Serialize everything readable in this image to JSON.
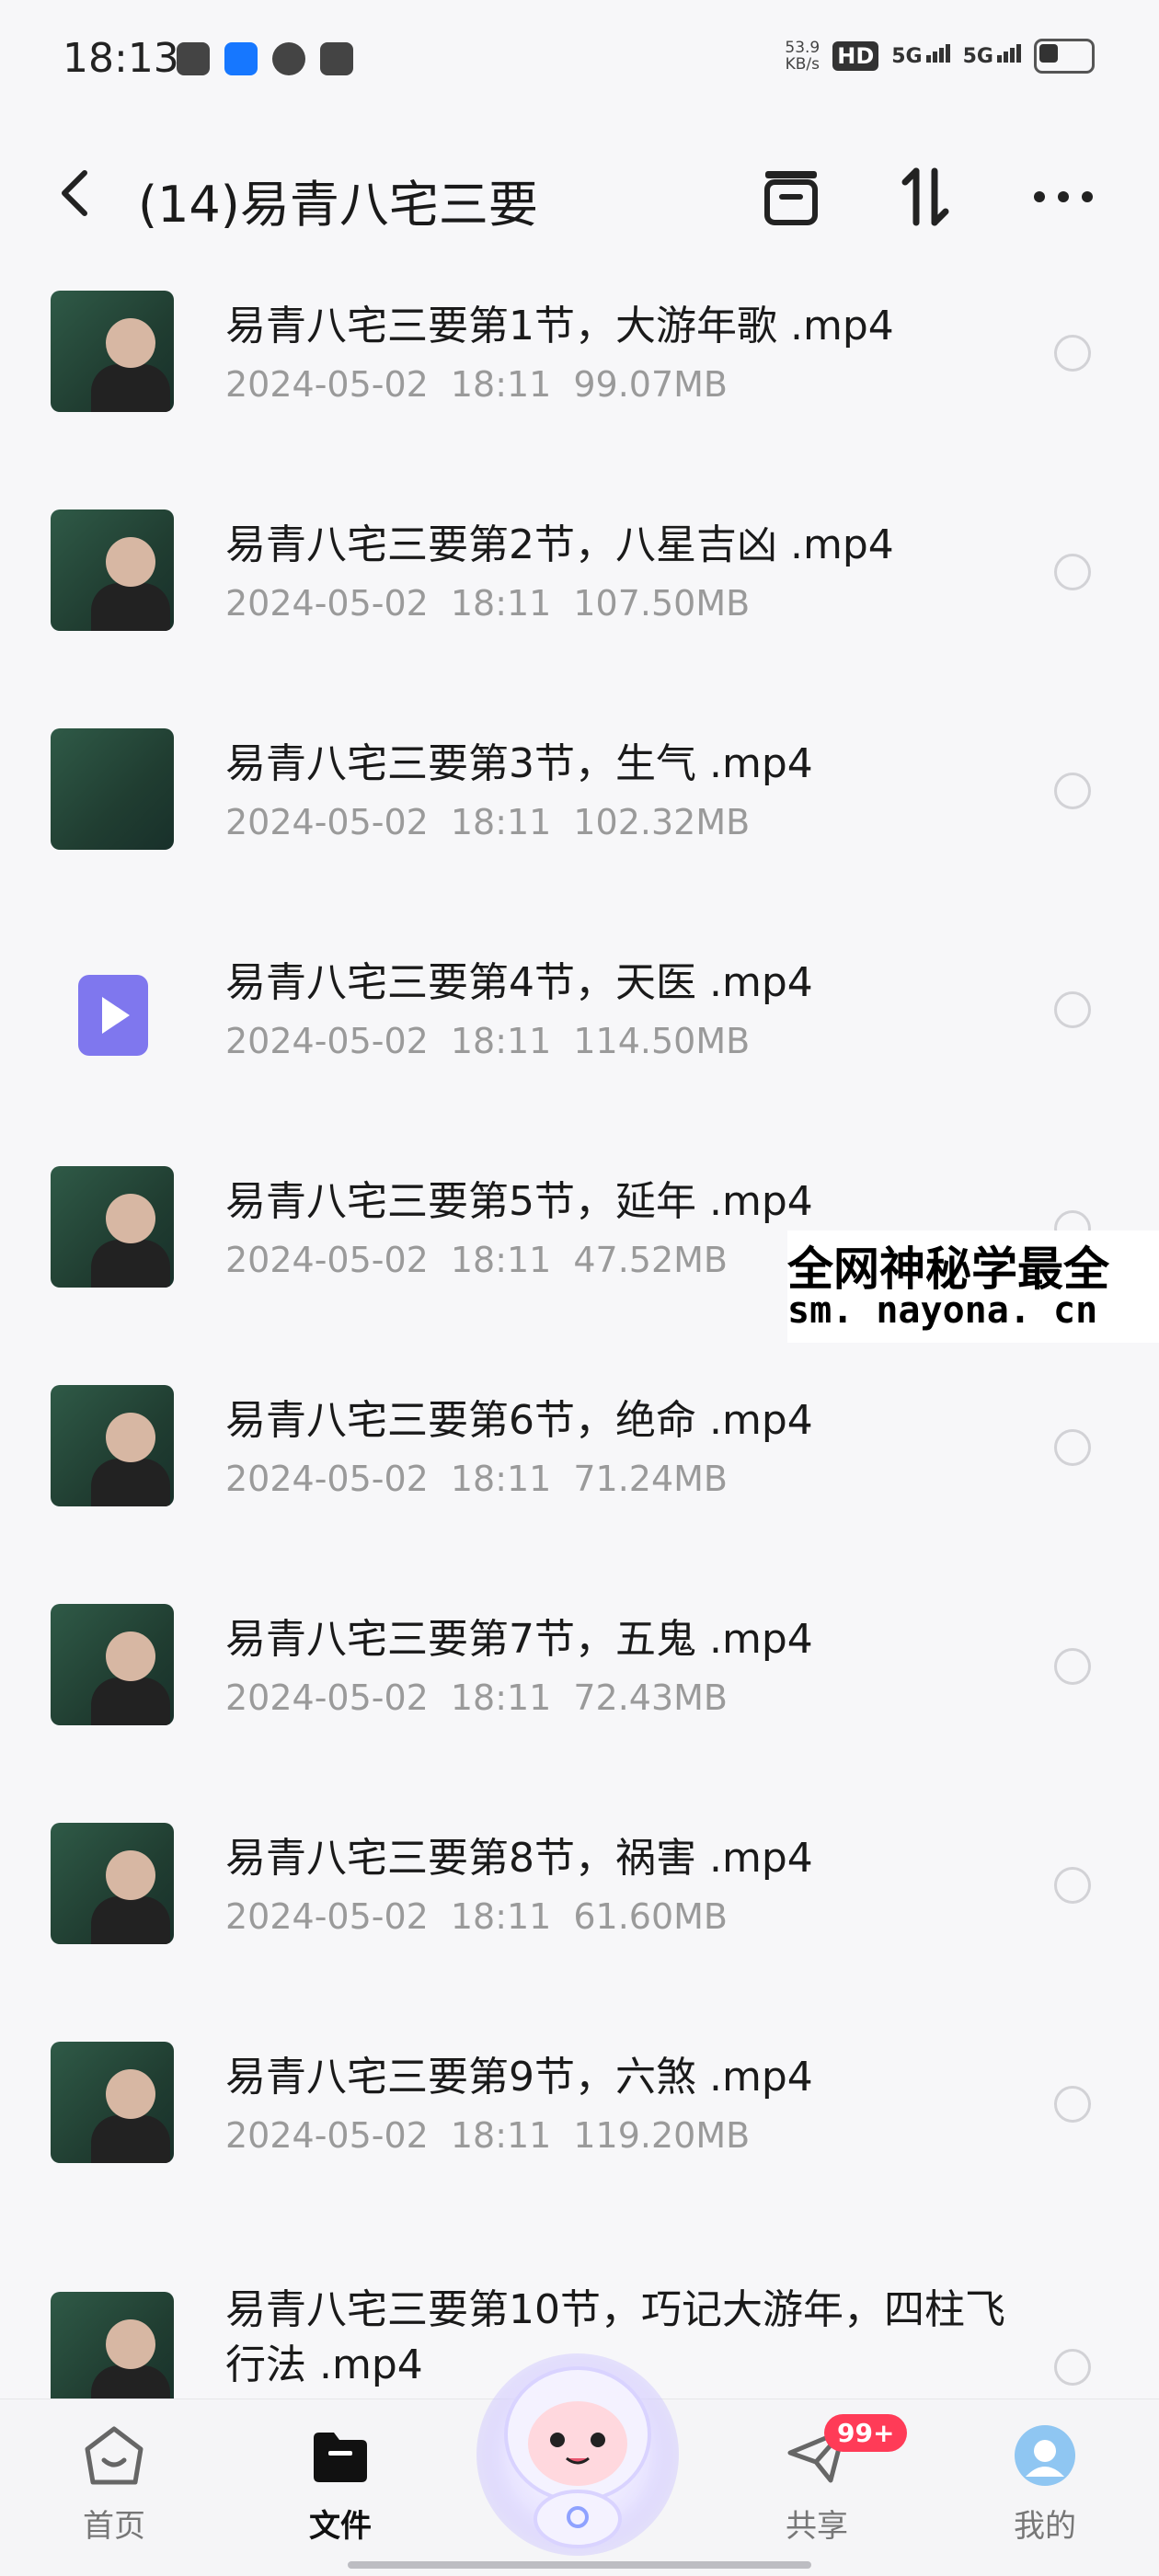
{
  "status_bar": {
    "time": "18:13",
    "speed_value": "53.9",
    "speed_unit": "KB/s",
    "hd": "HD",
    "sim1": "5G",
    "sim2": "5G"
  },
  "header": {
    "title": "(14)易青八宅三要"
  },
  "files": [
    {
      "name": "易青八宅三要第1节，大游年歌 .mp4",
      "date": "2024-05-02",
      "time": "18:11",
      "size": "99.07MB",
      "thumb": "video"
    },
    {
      "name": "易青八宅三要第2节，八星吉凶 .mp4",
      "date": "2024-05-02",
      "time": "18:11",
      "size": "107.50MB",
      "thumb": "video"
    },
    {
      "name": "易青八宅三要第3节，生气 .mp4",
      "date": "2024-05-02",
      "time": "18:11",
      "size": "102.32MB",
      "thumb": "video"
    },
    {
      "name": "易青八宅三要第4节，天医 .mp4",
      "date": "2024-05-02",
      "time": "18:11",
      "size": "114.50MB",
      "thumb": "play"
    },
    {
      "name": "易青八宅三要第5节，延年 .mp4",
      "date": "2024-05-02",
      "time": "18:11",
      "size": "47.52MB",
      "thumb": "video"
    },
    {
      "name": "易青八宅三要第6节，绝命 .mp4",
      "date": "2024-05-02",
      "time": "18:11",
      "size": "71.24MB",
      "thumb": "video"
    },
    {
      "name": "易青八宅三要第7节，五鬼 .mp4",
      "date": "2024-05-02",
      "time": "18:11",
      "size": "72.43MB",
      "thumb": "video"
    },
    {
      "name": "易青八宅三要第8节，祸害 .mp4",
      "date": "2024-05-02",
      "time": "18:11",
      "size": "61.60MB",
      "thumb": "video"
    },
    {
      "name": "易青八宅三要第9节，六煞 .mp4",
      "date": "2024-05-02",
      "time": "18:11",
      "size": "119.20MB",
      "thumb": "video"
    },
    {
      "name": "易青八宅三要第10节，巧记大游年，四柱飞行法 .mp4",
      "date": "",
      "time": "",
      "size": "",
      "thumb": "video"
    }
  ],
  "watermark": {
    "line1": "全网神秘学最全",
    "line2": "sm. nayona. cn"
  },
  "nav": {
    "home": "首页",
    "files": "文件",
    "share": "共享",
    "share_badge": "99+",
    "mine": "我的"
  },
  "icons": [
    "back-arrow-icon",
    "archive-icon",
    "sort-icon",
    "more-icon",
    "play-icon",
    "home-icon",
    "folder-icon",
    "paper-plane-icon",
    "avatar-icon"
  ],
  "colors": {
    "accent": "#7f77ee",
    "badge": "#ff3b57"
  }
}
